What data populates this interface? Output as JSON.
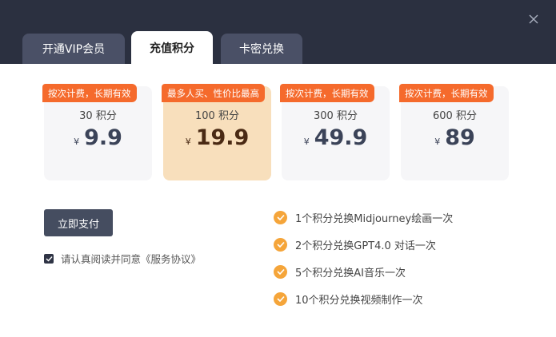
{
  "tabs": [
    {
      "label": "开通VIP会员",
      "active": false
    },
    {
      "label": "充值积分",
      "active": true
    },
    {
      "label": "卡密兑换",
      "active": false
    }
  ],
  "packages": [
    {
      "badge": "按次计费，长期有效",
      "points": "30 积分",
      "currency": "¥",
      "price": "9.9",
      "selected": false
    },
    {
      "badge": "最多人买、性价比最高",
      "points": "100 积分",
      "currency": "¥",
      "price": "19.9",
      "selected": true
    },
    {
      "badge": "按次计费，长期有效",
      "points": "300 积分",
      "currency": "¥",
      "price": "49.9",
      "selected": false
    },
    {
      "badge": "按次计费，长期有效",
      "points": "600 积分",
      "currency": "¥",
      "price": "89",
      "selected": false
    }
  ],
  "pay_button": "立即支付",
  "agreement": {
    "text": "请认真阅读并同意《服务协议》",
    "checked": true
  },
  "features": [
    "1个积分兑换Midjourney绘画一次",
    "2个积分兑换GPT4.0 对话一次",
    "5个积分兑换AI音乐一次",
    "10个积分兑换视频制作一次"
  ],
  "colors": {
    "header_bg": "#2b3040",
    "badge": "#f56a2c",
    "selected_card": "#f8dfbc",
    "check": "#f5a53a"
  }
}
